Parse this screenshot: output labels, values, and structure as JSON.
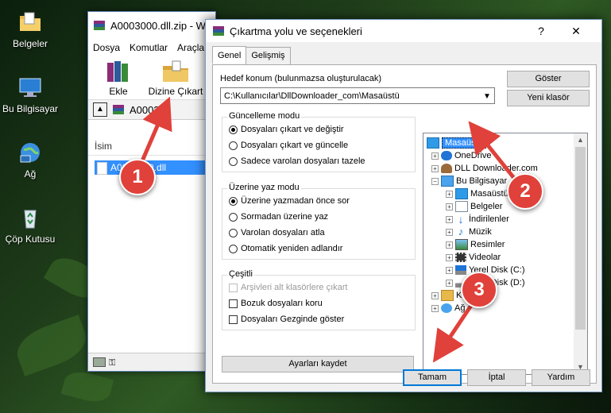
{
  "desktop": {
    "icons": [
      {
        "label": "Belgeler"
      },
      {
        "label": "Bu Bilgisayar"
      },
      {
        "label": "Ağ"
      },
      {
        "label": "Çöp Kutusu"
      }
    ]
  },
  "winrar": {
    "title": "A0003000.dll.zip - W",
    "menu": [
      "Dosya",
      "Komutlar",
      "Araçla"
    ],
    "toolbar": {
      "add_label": "Ekle",
      "extract_label": "Dizine Çıkart"
    },
    "path": "A000300",
    "column_name": "İsim",
    "file_row": "A0003000.dll"
  },
  "dialog": {
    "title": "Çıkartma yolu ve seçenekleri",
    "help_glyph": "?",
    "close_glyph": "✕",
    "tabs": [
      "Genel",
      "Gelişmiş"
    ],
    "destination_label": "Hedef konum (bulunmazsa oluşturulacak)",
    "destination_value": "C:\\Kullanıcılar\\DllDownloader_com\\Masaüstü",
    "show_button": "Göster",
    "new_folder_button": "Yeni klasör",
    "update_group": {
      "title": "Güncelleme modu",
      "options": [
        {
          "label": "Dosyaları çıkart ve değiştir",
          "selected": true
        },
        {
          "label": "Dosyaları çıkart ve güncelle",
          "selected": false
        },
        {
          "label": "Sadece varolan dosyaları tazele",
          "selected": false
        }
      ]
    },
    "overwrite_group": {
      "title": "Üzerine yaz modu",
      "options": [
        {
          "label": "Üzerine yazmadan önce sor",
          "selected": true
        },
        {
          "label": "Sormadan üzerine yaz",
          "selected": false
        },
        {
          "label": "Varolan dosyaları atla",
          "selected": false
        },
        {
          "label": "Otomatik yeniden adlandır",
          "selected": false
        }
      ]
    },
    "misc_group": {
      "title": "Çeşitli",
      "options": [
        {
          "label": "Arşivleri alt klasörlere çıkart",
          "checked": false,
          "disabled": true
        },
        {
          "label": "Bozuk dosyaları koru",
          "checked": false,
          "disabled": false
        },
        {
          "label": "Dosyaları Gezginde göster",
          "checked": false,
          "disabled": false
        }
      ]
    },
    "save_settings_button": "Ayarları kaydet",
    "tree": [
      {
        "label": "Masaüstü",
        "selected": true
      },
      {
        "label": "OneDrive"
      },
      {
        "label": "DLL Downloader.com"
      },
      {
        "label": "Bu Bilgisayar"
      },
      {
        "label": "Masaüstü"
      },
      {
        "label": "Belgeler"
      },
      {
        "label": "İndirilenler"
      },
      {
        "label": "Müzik"
      },
      {
        "label": "Resimler"
      },
      {
        "label": "Videolar"
      },
      {
        "label": "Yerel Disk (C:)"
      },
      {
        "label": "Yerel Disk (D:)"
      },
      {
        "label": "Kitaplıklar"
      },
      {
        "label": "Ağ"
      }
    ],
    "ok_button": "Tamam",
    "cancel_button": "İptal",
    "help_button": "Yardım"
  },
  "annotations": [
    "1",
    "2",
    "3"
  ],
  "colors": {
    "annotation": "#e0413a",
    "selection": "#3390ff"
  }
}
